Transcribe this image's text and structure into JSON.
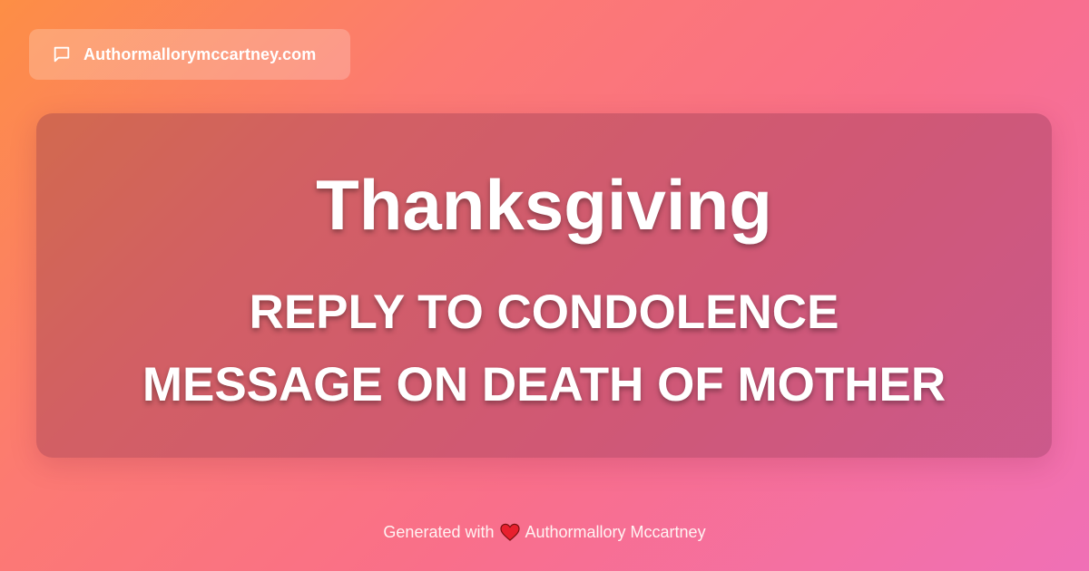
{
  "badge": {
    "icon": "chat-bubble-icon",
    "site_name": "Authormallorymccartney.com"
  },
  "card": {
    "title": "Thanksgiving",
    "subtitle_line1": "REPLY TO CONDOLENCE",
    "subtitle_line2": "MESSAGE ON DEATH OF MOTHER"
  },
  "footer": {
    "prefix": "Generated with",
    "icon": "heart-icon",
    "author": "Authormallory Mccartney"
  },
  "colors": {
    "gradient_start": "#fd8e45",
    "gradient_end": "#f070b6",
    "heart": "#e8202e",
    "text": "#ffffff"
  }
}
